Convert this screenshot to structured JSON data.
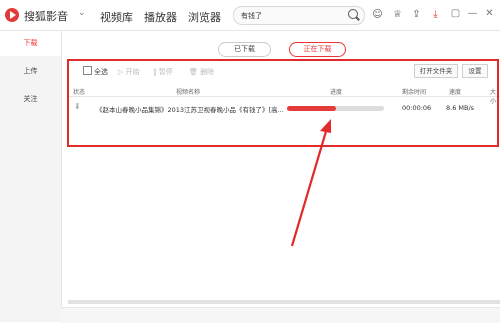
{
  "app": {
    "name": "搜狐影音",
    "nav": [
      "视频库",
      "播放器",
      "浏览器"
    ],
    "search_value": "有钱了"
  },
  "sidebar": {
    "items": [
      "下载",
      "上传",
      "关注"
    ],
    "active": 0
  },
  "tabs": {
    "downloaded": "已下载",
    "downloading": "正在下载"
  },
  "toolbar": {
    "select_all": "全选",
    "start": "开始",
    "pause": "暂停",
    "delete": "删除",
    "open_folder": "打开文件夹",
    "settings": "设置"
  },
  "table": {
    "headers": {
      "status": "状态",
      "name": "视频名称",
      "progress": "进度",
      "remaining": "剩余时间",
      "speed": "速度",
      "size": "大小"
    },
    "rows": [
      {
        "name": "《赵本山春晚小品集锦》2013江苏卫视春晚小品《有钱了》[高...",
        "progress": 0.5,
        "remaining": "00:00:06",
        "speed": "8.6 MB/s"
      }
    ]
  },
  "colors": {
    "accent": "#e33a3a",
    "annotation": "#e32a2a"
  }
}
